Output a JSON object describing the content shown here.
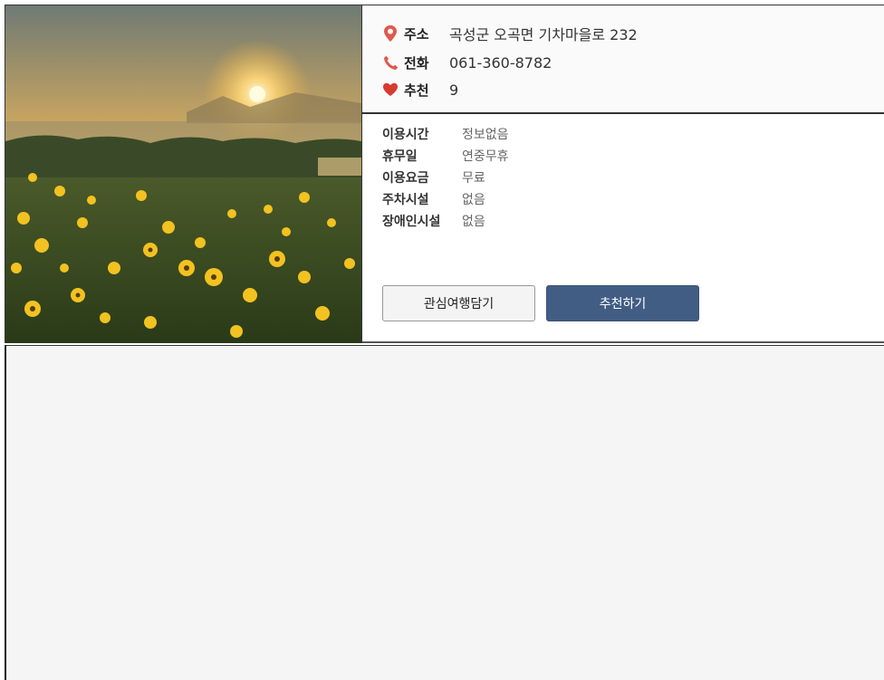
{
  "info": {
    "address_label": "주소",
    "address_value": "곡성군 오곡면 기차마을로 232",
    "phone_label": "전화",
    "phone_value": "061-360-8782",
    "recommend_label": "추천",
    "recommend_value": "9"
  },
  "details": [
    {
      "label": "이용시간",
      "value": "정보없음"
    },
    {
      "label": "휴무일",
      "value": "연중무휴"
    },
    {
      "label": "이용요금",
      "value": "무료"
    },
    {
      "label": "주차시설",
      "value": "없음"
    },
    {
      "label": "장애인시설",
      "value": "없음"
    }
  ],
  "buttons": {
    "wishlist_label": "관심여행담기",
    "recommend_label": "추천하기"
  },
  "icons": {
    "address": "map-pin-icon",
    "phone": "phone-icon",
    "recommend": "heart-icon"
  },
  "colors": {
    "pin": "#e2574c",
    "phone": "#e2574c",
    "heart": "#d63b30",
    "primary_button": "#425d84"
  }
}
